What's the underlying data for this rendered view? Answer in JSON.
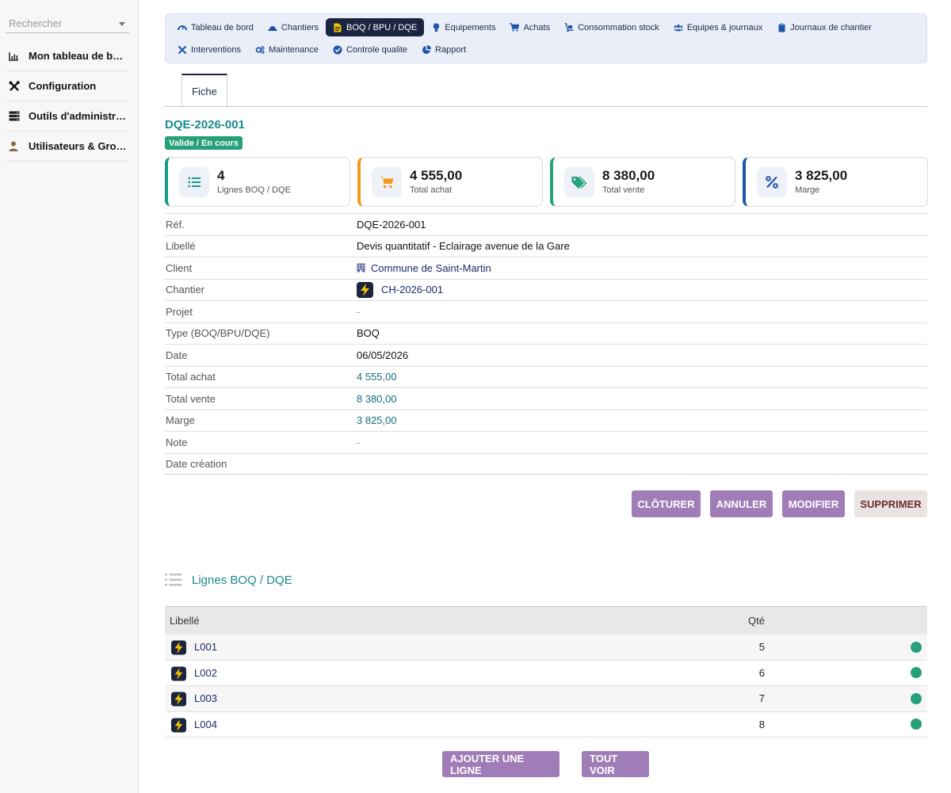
{
  "sidebar": {
    "search_placeholder": "Rechercher",
    "items": [
      {
        "label": "Mon tableau de bord",
        "icon": "bar-chart-icon"
      },
      {
        "label": "Configuration",
        "icon": "tools-icon"
      },
      {
        "label": "Outils d'administration",
        "icon": "server-icon"
      },
      {
        "label": "Utilisateurs & Groupes",
        "icon": "user-icon"
      }
    ]
  },
  "topnav": {
    "row1": [
      {
        "label": "Tableau de bord",
        "icon": "gauge-icon"
      },
      {
        "label": "Chantiers",
        "icon": "hard-hat-icon"
      },
      {
        "label": "BOQ / BPU / DQE",
        "icon": "document-icon",
        "active": true
      },
      {
        "label": "Equipements",
        "icon": "bulb-icon"
      },
      {
        "label": "Achats",
        "icon": "cart-icon"
      },
      {
        "label": "Consommation stock",
        "icon": "dolly-icon"
      },
      {
        "label": "Equipes & journaux",
        "icon": "users-icon"
      },
      {
        "label": "Journaux de chantier",
        "icon": "clipboard-icon"
      }
    ],
    "row2": [
      {
        "label": "Interventions",
        "icon": "tools-icon"
      },
      {
        "label": "Maintenance",
        "icon": "cogs-icon"
      },
      {
        "label": "Controle qualite",
        "icon": "check-circle-icon"
      },
      {
        "label": "Rapport",
        "icon": "pie-chart-icon"
      }
    ]
  },
  "tab": {
    "label": "Fiche"
  },
  "record": {
    "ref": "DQE-2026-001",
    "status": "Valide / En cours"
  },
  "kpis": [
    {
      "value": "4",
      "label": "Lignes BOQ / DQE",
      "icon": "list-icon",
      "color": "#1a9a8f"
    },
    {
      "value": "4 555,00",
      "label": "Total achat",
      "icon": "cart-icon",
      "color": "#f39a1a"
    },
    {
      "value": "8 380,00",
      "label": "Total vente",
      "icon": "tag-icon",
      "color": "#25a07a"
    },
    {
      "value": "3 825,00",
      "label": "Marge",
      "icon": "percent-icon",
      "color": "#1f56a8"
    }
  ],
  "details": {
    "ref": {
      "label": "Réf.",
      "value": "DQE-2026-001"
    },
    "libelle": {
      "label": "Libellé",
      "value": "Devis quantitatif - Eclairage avenue de la Gare"
    },
    "client": {
      "label": "Client",
      "value": "Commune de Saint-Martin"
    },
    "chantier": {
      "label": "Chantier",
      "value": "CH-2026-001"
    },
    "projet": {
      "label": "Projet",
      "value": "-"
    },
    "type": {
      "label": "Type (BOQ/BPU/DQE)",
      "value": "BOQ"
    },
    "date": {
      "label": "Date",
      "value": "06/05/2026"
    },
    "total_achat": {
      "label": "Total achat",
      "value": "4 555,00"
    },
    "total_vente": {
      "label": "Total vente",
      "value": "8 380,00"
    },
    "marge": {
      "label": "Marge",
      "value": "3 825,00"
    },
    "note": {
      "label": "Note",
      "value": "-"
    },
    "date_creation": {
      "label": "Date création",
      "value": ""
    }
  },
  "actions": {
    "close": "CLÔTURER",
    "cancel": "ANNULER",
    "edit": "MODIFIER",
    "delete": "SUPPRIMER"
  },
  "lines": {
    "title": "Lignes BOQ / DQE",
    "headers": {
      "libelle": "Libellé",
      "qty": "Qté"
    },
    "rows": [
      {
        "code": "L001",
        "qty": "5"
      },
      {
        "code": "L002",
        "qty": "6"
      },
      {
        "code": "L003",
        "qty": "7"
      },
      {
        "code": "L004",
        "qty": "8"
      }
    ],
    "add_label": "AJOUTER UNE LIGNE",
    "see_all_label": "TOUT VOIR"
  }
}
